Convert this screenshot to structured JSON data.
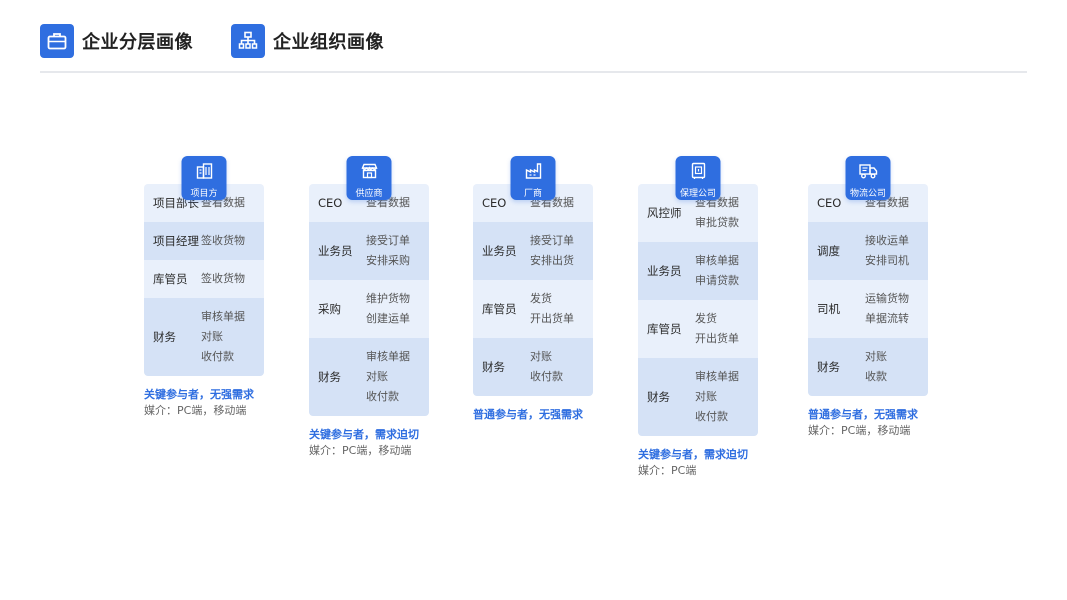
{
  "header": {
    "tabs": [
      {
        "label": "企业分层画像",
        "icon": "briefcase-icon"
      },
      {
        "label": "企业组织画像",
        "icon": "org-chart-icon"
      }
    ]
  },
  "columns": [
    {
      "name": "项目方",
      "icon": "building-icon",
      "rows": [
        {
          "role": "项目部长",
          "actions": [
            "查看数据"
          ],
          "shade": "light"
        },
        {
          "role": "项目经理",
          "actions": [
            "签收货物"
          ],
          "shade": "dark"
        },
        {
          "role": "库管员",
          "actions": [
            "签收货物"
          ],
          "shade": "light"
        },
        {
          "role": "财务",
          "actions": [
            "审核单据",
            "对账",
            "收付款"
          ],
          "shade": "dark"
        }
      ],
      "participant": "关键参与者，无强需求",
      "media": "媒介：PC端，移动端"
    },
    {
      "name": "供应商",
      "icon": "store-icon",
      "rows": [
        {
          "role": "CEO",
          "actions": [
            "查看数据"
          ],
          "shade": "light"
        },
        {
          "role": "业务员",
          "actions": [
            "接受订单",
            "安排采购"
          ],
          "shade": "dark"
        },
        {
          "role": "采购",
          "actions": [
            "维护货物",
            "创建运单"
          ],
          "shade": "light"
        },
        {
          "role": "财务",
          "actions": [
            "审核单据",
            "对账",
            "收付款"
          ],
          "shade": "dark"
        }
      ],
      "participant": "关键参与者，需求迫切",
      "media": "媒介：PC端，移动端"
    },
    {
      "name": "厂商",
      "icon": "factory-icon",
      "rows": [
        {
          "role": "CEO",
          "actions": [
            "查看数据"
          ],
          "shade": "light"
        },
        {
          "role": "业务员",
          "actions": [
            "接受订单",
            "安排出货"
          ],
          "shade": "dark"
        },
        {
          "role": "库管员",
          "actions": [
            "发货",
            "开出货单"
          ],
          "shade": "light"
        },
        {
          "role": "财务",
          "actions": [
            "对账",
            "收付款"
          ],
          "shade": "dark"
        }
      ],
      "participant": "普通参与者，无强需求",
      "media": ""
    },
    {
      "name": "保理公司",
      "icon": "safe-icon",
      "rows": [
        {
          "role": "风控师",
          "actions": [
            "查看数据",
            "审批贷款"
          ],
          "shade": "light"
        },
        {
          "role": "业务员",
          "actions": [
            "审核单据",
            "申请贷款"
          ],
          "shade": "dark"
        },
        {
          "role": "库管员",
          "actions": [
            "发货",
            "开出货单"
          ],
          "shade": "light"
        },
        {
          "role": "财务",
          "actions": [
            "审核单据",
            "对账",
            "收付款"
          ],
          "shade": "dark"
        }
      ],
      "participant": "关键参与者，需求迫切",
      "media": "媒介：PC端"
    },
    {
      "name": "物流公司",
      "icon": "truck-icon",
      "rows": [
        {
          "role": "CEO",
          "actions": [
            "查看数据"
          ],
          "shade": "light"
        },
        {
          "role": "调度",
          "actions": [
            "接收运单",
            "安排司机"
          ],
          "shade": "dark"
        },
        {
          "role": "司机",
          "actions": [
            "运输货物",
            "单据流转"
          ],
          "shade": "light"
        },
        {
          "role": "财务",
          "actions": [
            "对账",
            "收款"
          ],
          "shade": "dark"
        }
      ],
      "participant": "普通参与者，无强需求",
      "media": "媒介：PC端，移动端"
    }
  ]
}
